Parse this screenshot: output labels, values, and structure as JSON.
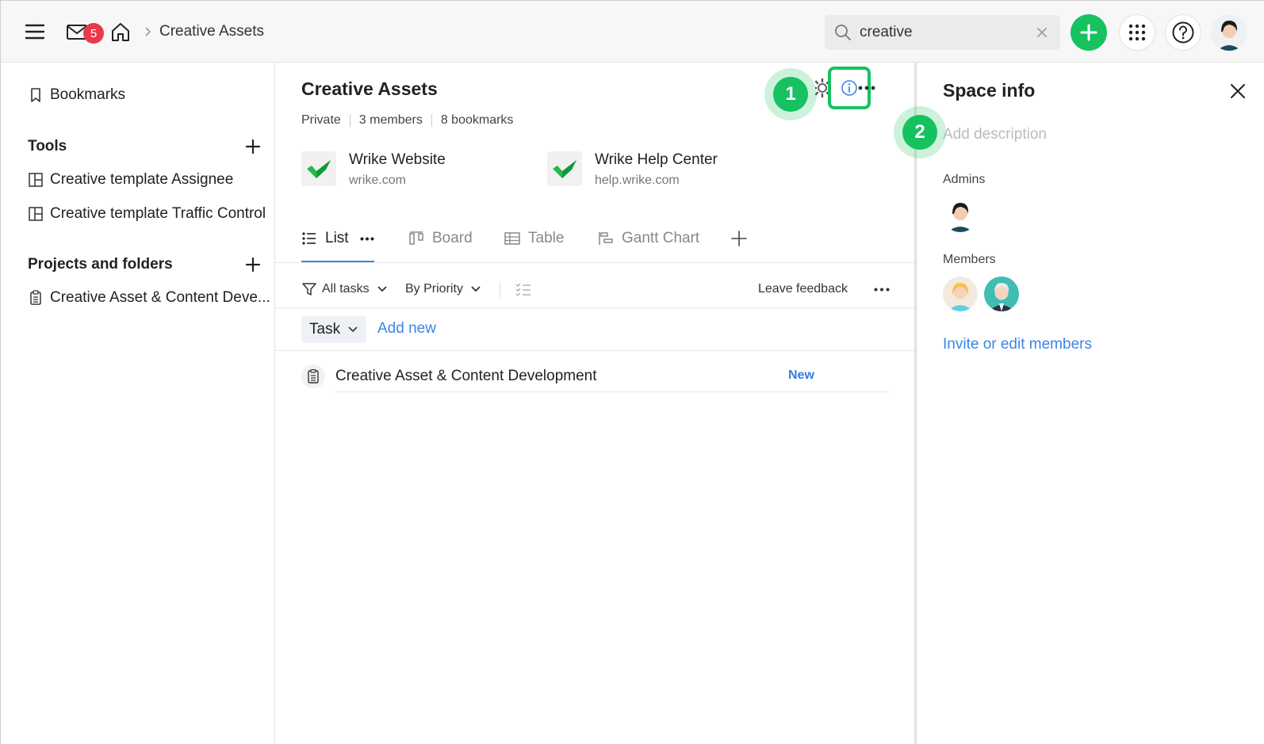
{
  "header": {
    "mail_badge": "5",
    "breadcrumb": "Creative Assets",
    "search_value": "creative"
  },
  "sidebar": {
    "bookmarks_label": "Bookmarks",
    "tools_heading": "Tools",
    "tools": [
      {
        "label": "Creative template Assignee"
      },
      {
        "label": "Creative template Traffic Control"
      }
    ],
    "projects_heading": "Projects and folders",
    "projects": [
      {
        "label": "Creative Asset & Content Deve..."
      }
    ]
  },
  "main": {
    "title": "Creative Assets",
    "meta": {
      "privacy": "Private",
      "members": "3 members",
      "bookmarks": "8 bookmarks"
    },
    "callouts": [
      "1",
      "2"
    ],
    "bookmark_cards": [
      {
        "title": "Wrike Website",
        "url": "wrike.com"
      },
      {
        "title": "Wrike Help Center",
        "url": "help.wrike.com"
      }
    ],
    "tabs": [
      {
        "label": "List"
      },
      {
        "label": "Board"
      },
      {
        "label": "Table"
      },
      {
        "label": "Gantt Chart"
      }
    ],
    "toolbar": {
      "filter_label": "All tasks",
      "sort_label": "By Priority",
      "feedback_label": "Leave feedback"
    },
    "task_type": "Task",
    "add_new": "Add new",
    "rows": [
      {
        "name": "Creative Asset & Content Development",
        "status": "New"
      }
    ]
  },
  "space_info": {
    "title": "Space info",
    "description_placeholder": "Add description",
    "admins_label": "Admins",
    "members_label": "Members",
    "invite_link": "Invite or edit members"
  },
  "colors": {
    "accent_green": "#16c25f",
    "link_blue": "#3b86e6",
    "badge_red": "#e8394a"
  }
}
